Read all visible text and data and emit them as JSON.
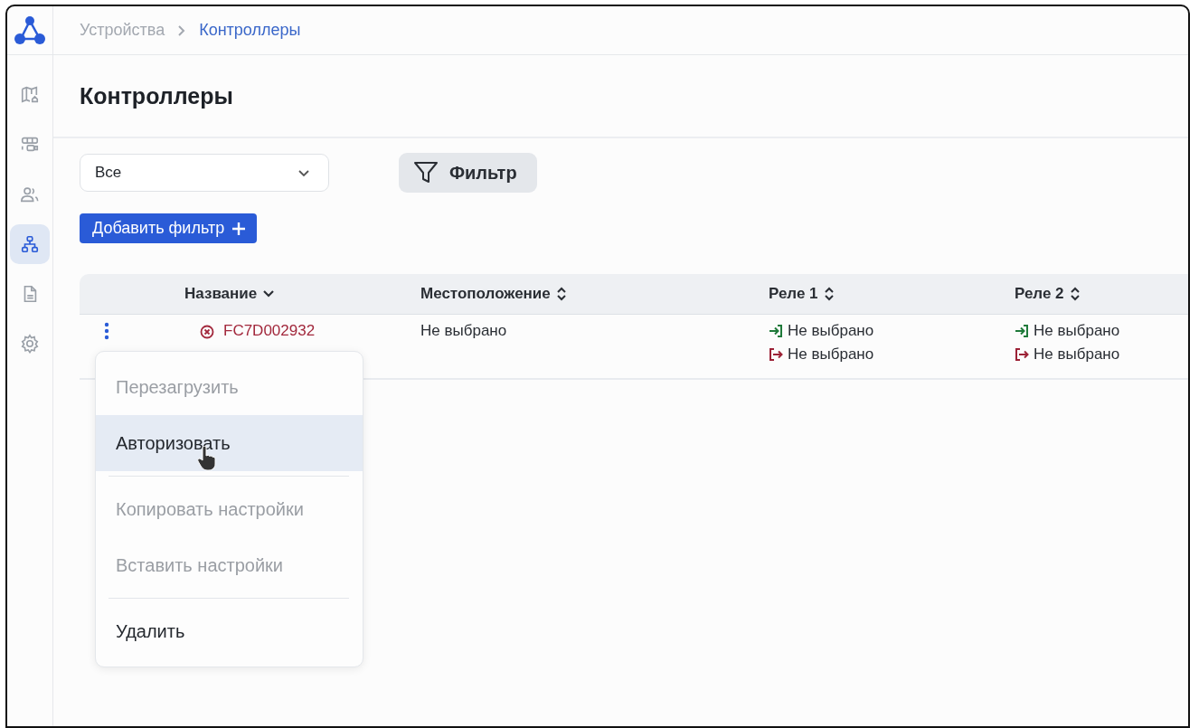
{
  "sidebar": {
    "items": [
      {
        "kind": "map",
        "selected": false
      },
      {
        "kind": "grid",
        "selected": false
      },
      {
        "kind": "users",
        "selected": false
      },
      {
        "kind": "hierarchy",
        "selected": true
      },
      {
        "kind": "document",
        "selected": false
      },
      {
        "kind": "settings",
        "selected": false
      }
    ]
  },
  "breadcrumb": [
    {
      "label": "Устройства",
      "current": false
    },
    {
      "label": "Контроллеры",
      "current": true
    }
  ],
  "title": "Контроллеры",
  "toolbar": {
    "select": {
      "value": "Все"
    },
    "filter_button": "Фильтр",
    "add_filter_button": "Добавить фильтр"
  },
  "table": {
    "columns": [
      {
        "label": "Название",
        "kind": "sorted"
      },
      {
        "label": "Местоположение",
        "kind": "sortable"
      },
      {
        "label": "Реле 1",
        "kind": "sortable"
      },
      {
        "label": "Реле 2",
        "kind": "sortable"
      }
    ],
    "rows": [
      {
        "name": "FC7D002932",
        "kind": "error",
        "location": "Не выбрано",
        "relay_1": [
          {
            "kind": "input",
            "label": "Не выбрано"
          },
          {
            "kind": "output",
            "label": "Не выбрано"
          }
        ],
        "relay_2": [
          {
            "kind": "input",
            "label": "Не выбрано"
          },
          {
            "kind": "output",
            "label": "Не выбрано"
          }
        ]
      }
    ]
  },
  "context_menu": {
    "items": [
      {
        "kind": "item",
        "label": "Перезагрузить",
        "disabled": true,
        "selected": false
      },
      {
        "kind": "item",
        "label": "Авторизовать",
        "disabled": false,
        "selected": true
      },
      {
        "kind": "separator"
      },
      {
        "kind": "item",
        "label": "Копировать настройки",
        "disabled": true,
        "selected": false
      },
      {
        "kind": "item",
        "label": "Вставить настройки",
        "disabled": true,
        "selected": false
      },
      {
        "kind": "separator"
      },
      {
        "kind": "item",
        "label": "Удалить",
        "disabled": false,
        "selected": false
      }
    ]
  }
}
